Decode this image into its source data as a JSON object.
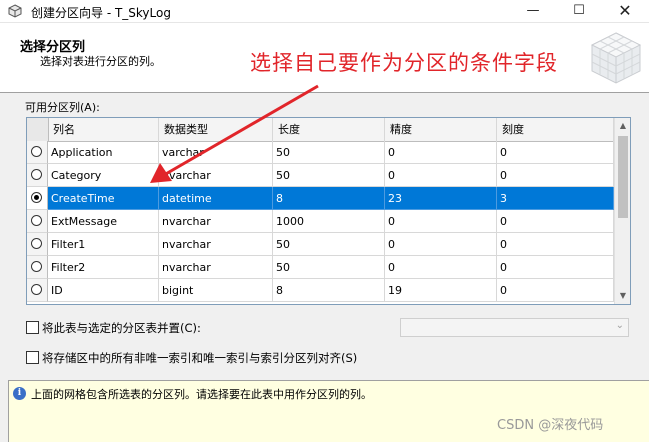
{
  "window": {
    "title": "创建分区向导 - T_SkyLog",
    "min_glyph": "—",
    "max_glyph": "☐",
    "close_glyph": "✕"
  },
  "header": {
    "title": "选择分区列",
    "subtitle": "选择对表进行分区的列。",
    "annotation": "选择自己要作为分区的条件字段",
    "annotation_color": "#e1252a",
    "logo_icon": "cube-grid-logo"
  },
  "grid": {
    "label": "可用分区列(A):",
    "columns": [
      "列名",
      "数据类型",
      "长度",
      "精度",
      "刻度"
    ],
    "rows": [
      {
        "name": "Application",
        "type": "varchar",
        "length": "50",
        "precision": "0",
        "scale": "0",
        "selected": false
      },
      {
        "name": "Category",
        "type": "nvarchar",
        "length": "50",
        "precision": "0",
        "scale": "0",
        "selected": false
      },
      {
        "name": "CreateTime",
        "type": "datetime",
        "length": "8",
        "precision": "23",
        "scale": "3",
        "selected": true
      },
      {
        "name": "ExtMessage",
        "type": "nvarchar",
        "length": "1000",
        "precision": "0",
        "scale": "0",
        "selected": false
      },
      {
        "name": "Filter1",
        "type": "nvarchar",
        "length": "50",
        "precision": "0",
        "scale": "0",
        "selected": false
      },
      {
        "name": "Filter2",
        "type": "nvarchar",
        "length": "50",
        "precision": "0",
        "scale": "0",
        "selected": false
      },
      {
        "name": "ID",
        "type": "bigint",
        "length": "8",
        "precision": "19",
        "scale": "0",
        "selected": false
      }
    ],
    "selection_color": "#0078d7"
  },
  "options": {
    "colocate_label": "将此表与选定的分区表并置(C):",
    "colocate_checked": false,
    "colocate_select_value": "",
    "align_label": "将存储区中的所有非唯一索引和唯一索引与索引分区列对齐(S)",
    "align_checked": false
  },
  "info": {
    "icon": "info-icon",
    "icon_glyph": "i",
    "text": "上面的网格包含所选表的分区列。请选择要在此表中用作分区列的列。"
  },
  "watermark": "CSDN @深夜代码"
}
